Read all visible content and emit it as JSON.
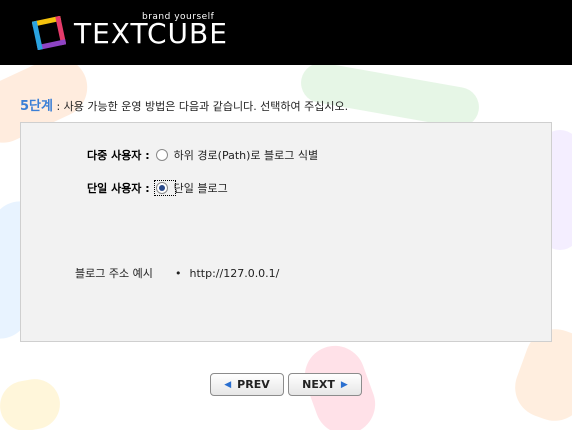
{
  "header": {
    "logo_text": "TEXTCUBE",
    "tagline": "brand yourself"
  },
  "step": {
    "number": "5단계",
    "instruction": " : 사용 가능한 운영 방법은 다음과 같습니다. 선택하여 주십시오."
  },
  "options": {
    "multi": {
      "label": "다중 사용자 :",
      "text": "하위 경로(Path)로 블로그 식별",
      "checked": false
    },
    "single": {
      "label": "단일 사용자 :",
      "text": "단일 블로그",
      "checked": true
    }
  },
  "address": {
    "label": "블로그 주소 예시",
    "bullet": "•",
    "value": "http://127.0.0.1/"
  },
  "buttons": {
    "prev_label": "PREV",
    "next_label": "NEXT"
  },
  "colors": {
    "header_bg": "#000000",
    "step_accent": "#3b7fd6",
    "arrow": "#2a6fd0",
    "panel_bg": "#f2f2f2"
  }
}
